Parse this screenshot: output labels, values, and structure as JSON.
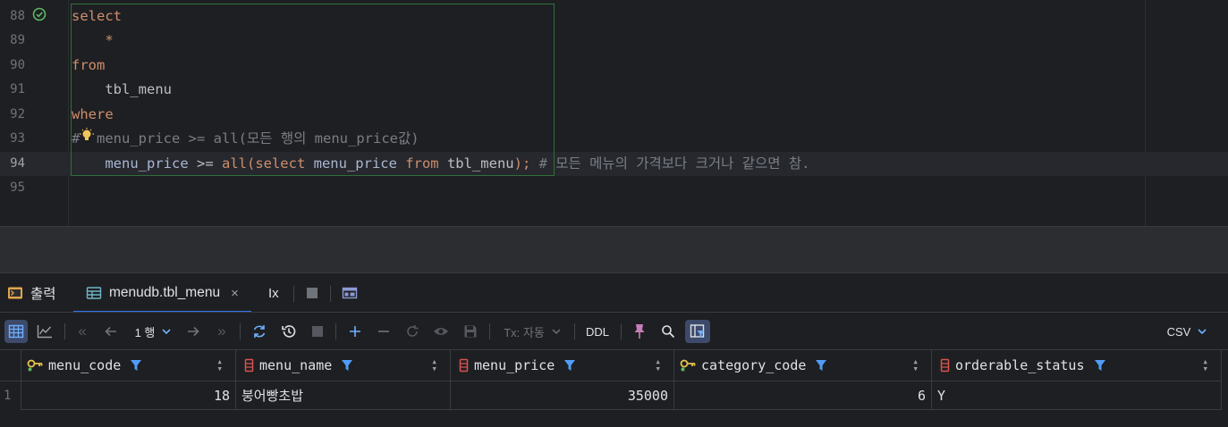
{
  "editor": {
    "lines": [
      {
        "num": "88",
        "tokens": [
          {
            "t": "select",
            "c": "kw"
          }
        ]
      },
      {
        "num": "89",
        "tokens": [
          {
            "t": "    ",
            "c": "id"
          },
          {
            "t": "*",
            "c": "kw"
          }
        ]
      },
      {
        "num": "90",
        "tokens": [
          {
            "t": "from",
            "c": "kw"
          }
        ]
      },
      {
        "num": "91",
        "tokens": [
          {
            "t": "    ",
            "c": "id"
          },
          {
            "t": "tbl_menu",
            "c": "id"
          }
        ]
      },
      {
        "num": "92",
        "tokens": [
          {
            "t": "where",
            "c": "kw"
          }
        ]
      },
      {
        "num": "93",
        "tokens": [
          {
            "t": "#  menu_price >= all(모든 행의 menu_price값)",
            "c": "cmt"
          }
        ]
      },
      {
        "num": "94",
        "tokens": [
          {
            "t": "    ",
            "c": "id"
          },
          {
            "t": "menu_price",
            "c": "col"
          },
          {
            "t": " >= ",
            "c": "id"
          },
          {
            "t": "all(",
            "c": "kw"
          },
          {
            "t": "select ",
            "c": "kw"
          },
          {
            "t": "menu_price ",
            "c": "col"
          },
          {
            "t": "from ",
            "c": "kw"
          },
          {
            "t": "tbl_menu",
            "c": "id"
          },
          {
            "t": ");",
            "c": "kw"
          },
          {
            "t": " # 모든 메뉴의 가격보다 크거나 같으면 참.",
            "c": "cmt"
          }
        ]
      },
      {
        "num": "95",
        "tokens": []
      }
    ]
  },
  "tabs": {
    "output_label": "출력",
    "result_label": "menudb.tbl_menu",
    "close_glyph": "×",
    "ix_label": "Ix"
  },
  "toolbar": {
    "row_selector": "1 행",
    "tx_label": "Tx: 자동",
    "ddl_label": "DDL",
    "export_label": "CSV"
  },
  "grid": {
    "columns": [
      {
        "name": "menu_code",
        "icon": "key-column-icon"
      },
      {
        "name": "menu_name",
        "icon": "column-icon"
      },
      {
        "name": "menu_price",
        "icon": "column-icon"
      },
      {
        "name": "category_code",
        "icon": "key-column-icon"
      },
      {
        "name": "orderable_status",
        "icon": "column-icon"
      }
    ],
    "rows": [
      {
        "num": "1",
        "cells": [
          "18",
          "붕어빵초밥",
          "35000",
          "6",
          "Y"
        ]
      }
    ]
  },
  "colors": {
    "keyword": "#cf8e6d",
    "comment": "#7a7e85",
    "column": "#a9b7d0",
    "accent": "#3574f0",
    "filter": "#4f9cf9"
  }
}
